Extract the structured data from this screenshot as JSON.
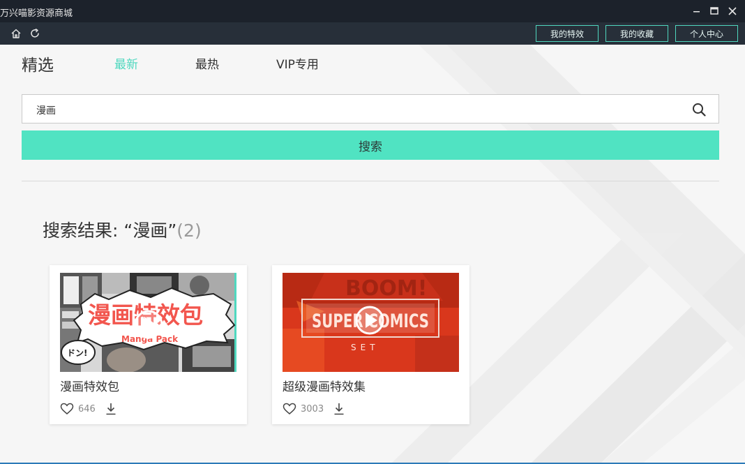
{
  "window": {
    "title": "万兴喵影资源商城"
  },
  "toolbar": {
    "buttons": [
      "我的特效",
      "我的收藏",
      "个人中心"
    ]
  },
  "nav": {
    "main": "精选",
    "tabs": [
      "最新",
      "最热",
      "VIP专用"
    ],
    "active_tab": "最新"
  },
  "search": {
    "value": "漫画",
    "button_label": "搜索"
  },
  "results": {
    "title": "搜索结果: “漫画”",
    "count": "(2)",
    "items": [
      {
        "title": "漫画特效包",
        "likes": "646",
        "thumb_text": "漫画特效包",
        "thumb_sub": "Manga Pack",
        "thumb_bubble": "ドン!"
      },
      {
        "title": "超级漫画特效集",
        "likes": "3003",
        "thumb_text": "SUPER COMICS",
        "thumb_sub": "SET"
      }
    ]
  },
  "colors": {
    "accent": "#50e3c2",
    "titlebar": "#1c222b",
    "toolbar": "#272f39"
  }
}
